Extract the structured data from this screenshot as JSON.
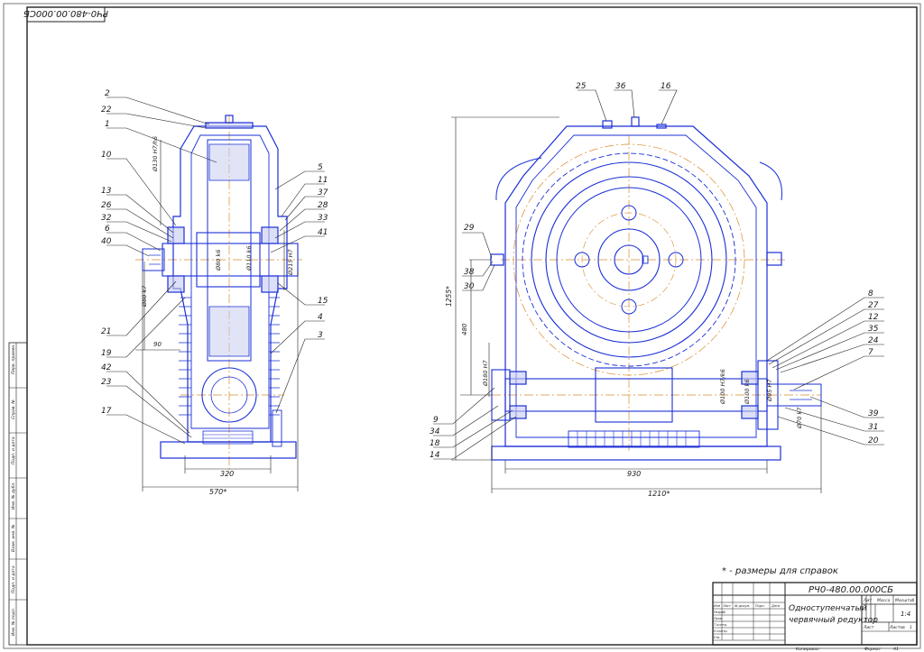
{
  "sheet": {
    "corner_stamp": "РЧ0-480.00.000СБ",
    "note": "* - размеры для справок",
    "title_block": {
      "designation": "РЧ0-480.00.000СБ",
      "name_line1": "Одноступенчатый",
      "name_line2": "червячный редуктор",
      "sheet_label": "Лист",
      "sheets_label": "Листов",
      "sheets_count": "1",
      "mass_label": "Масса",
      "scale_label": "Масштаб",
      "lit_label": "Лит",
      "scale_value": "1:4",
      "format_label": "Формат",
      "format_value": "A1",
      "copied_label": "Копировал",
      "rows": [
        "Изм",
        "Лист",
        "№ докум.",
        "Подп.",
        "Дата"
      ],
      "roles": [
        "Разраб.",
        "Пров.",
        "Т.контр.",
        "Н.контр.",
        "Утв."
      ]
    },
    "side_stamp": [
      "Перв. примен.",
      "Справ. №",
      "Подп. и дата",
      "Инв. № дубл.",
      "Взам. инв. №",
      "Подп. и дата",
      "Инв. № подл."
    ]
  },
  "left_view": {
    "callouts": [
      "2",
      "22",
      "1",
      "10",
      "13",
      "26",
      "32",
      "6",
      "40",
      "21",
      "19",
      "42",
      "23",
      "17",
      "5",
      "11",
      "37",
      "28",
      "33",
      "41",
      "15",
      "4",
      "3"
    ],
    "dimensions": {
      "d_top": "Ø130 H7/h6",
      "d_shaft": "Ø80 k6",
      "d_bearing": "Ø110 k6",
      "d_housing": "Ø215 H7",
      "d_out": "Ø80 k7",
      "len_90": "90",
      "base_320": "320",
      "overall_570": "570*"
    }
  },
  "right_view": {
    "callouts_top": [
      "25",
      "36",
      "16"
    ],
    "callouts_left": [
      "29",
      "38",
      "30"
    ],
    "callouts_bottom_left": [
      "9",
      "34",
      "18",
      "14"
    ],
    "callouts_right": [
      "8",
      "27",
      "12",
      "35",
      "24",
      "7",
      "39",
      "31",
      "20"
    ],
    "dimensions": {
      "height_1255": "1255*",
      "height_480": "480",
      "d_left": "Ø180 H7",
      "d_worm1": "Ø100 H7/k6",
      "d_worm2": "Ø100 k6",
      "d_worm3": "Ø95 H7",
      "d_worm4": "Ø70 k7",
      "base_930": "930",
      "overall_1210": "1210*"
    }
  }
}
